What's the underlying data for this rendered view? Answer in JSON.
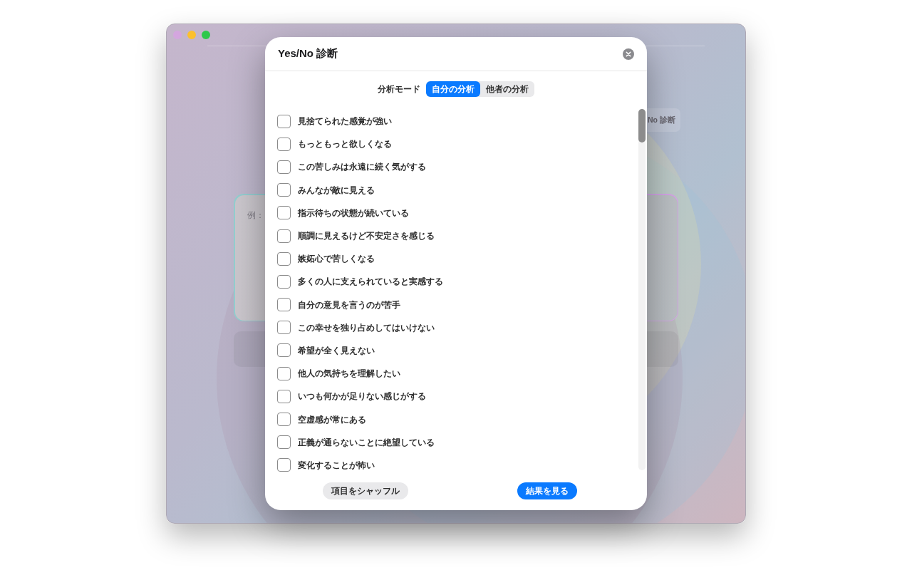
{
  "background_window": {
    "top_button": {
      "label": "No 診断"
    },
    "text_area": {
      "placeholder": "例："
    }
  },
  "dialog": {
    "title": "Yes/No 診断",
    "mode": {
      "label": "分析モード",
      "options": [
        {
          "label": "自分の分析",
          "selected": true
        },
        {
          "label": "他者の分析",
          "selected": false
        }
      ]
    },
    "items": [
      {
        "label": "見捨てられた感覚が強い",
        "checked": false
      },
      {
        "label": "もっともっと欲しくなる",
        "checked": false
      },
      {
        "label": "この苦しみは永遠に続く気がする",
        "checked": false
      },
      {
        "label": "みんなが敵に見える",
        "checked": false
      },
      {
        "label": "指示待ちの状態が続いている",
        "checked": false
      },
      {
        "label": "順調に見えるけど不安定さを感じる",
        "checked": false
      },
      {
        "label": "嫉妬心で苦しくなる",
        "checked": false
      },
      {
        "label": "多くの人に支えられていると実感する",
        "checked": false
      },
      {
        "label": "自分の意見を言うのが苦手",
        "checked": false
      },
      {
        "label": "この幸せを独り占めしてはいけない",
        "checked": false
      },
      {
        "label": "希望が全く見えない",
        "checked": false
      },
      {
        "label": "他人の気持ちを理解したい",
        "checked": false
      },
      {
        "label": "いつも何かが足りない感じがする",
        "checked": false
      },
      {
        "label": "空虚感が常にある",
        "checked": false
      },
      {
        "label": "正義が通らないことに絶望している",
        "checked": false
      },
      {
        "label": "変化することが怖い",
        "checked": false
      }
    ],
    "buttons": [
      {
        "label": "項目をシャッフル",
        "kind": "secondary"
      },
      {
        "label": "結果を見る",
        "kind": "primary"
      }
    ]
  }
}
